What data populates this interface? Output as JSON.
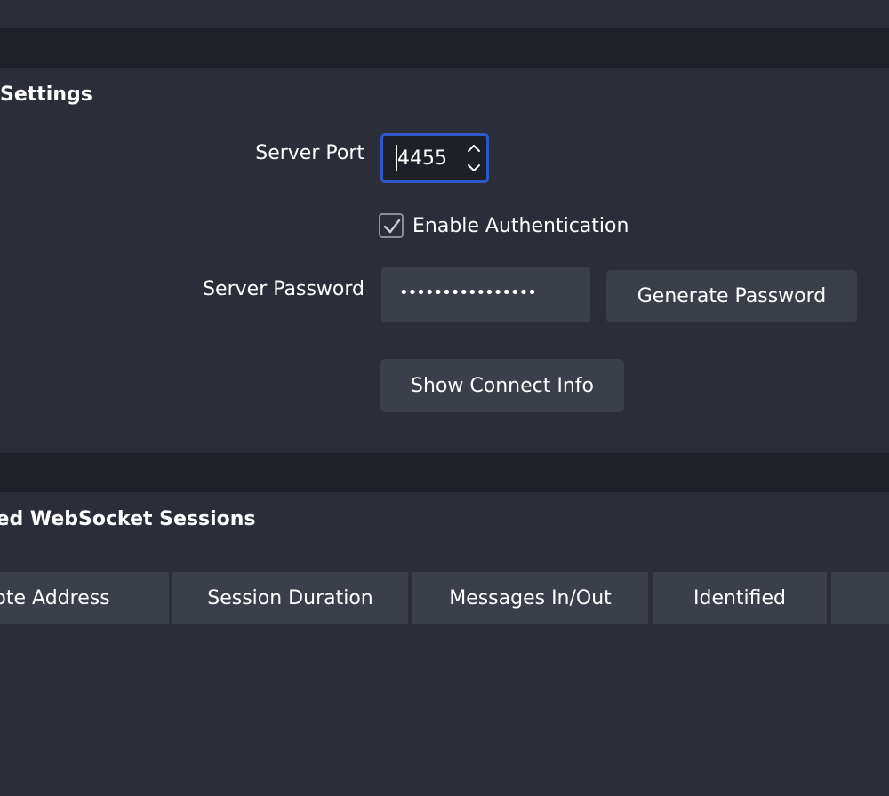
{
  "server_settings": {
    "title": "Settings",
    "port": {
      "label": "Server Port",
      "value": "4455"
    },
    "auth": {
      "label": "Enable Authentication",
      "checked": true
    },
    "password": {
      "label": "Server Password",
      "masked_value": "••••••••••••••••"
    },
    "generate_button": "Generate Password",
    "connect_info_button": "Show Connect Info"
  },
  "sessions": {
    "title": "cted WebSocket Sessions",
    "columns": [
      "mote Address",
      "Session Duration",
      "Messages In/Out",
      "Identified",
      ""
    ]
  },
  "colors": {
    "background": "#2b2e38",
    "band": "#1f2129",
    "control": "#3b3f4a",
    "focus_border": "#2f56c8"
  },
  "icons": {
    "spin_up": "chevron-up-icon",
    "spin_down": "chevron-down-icon",
    "check": "checkmark-icon"
  }
}
